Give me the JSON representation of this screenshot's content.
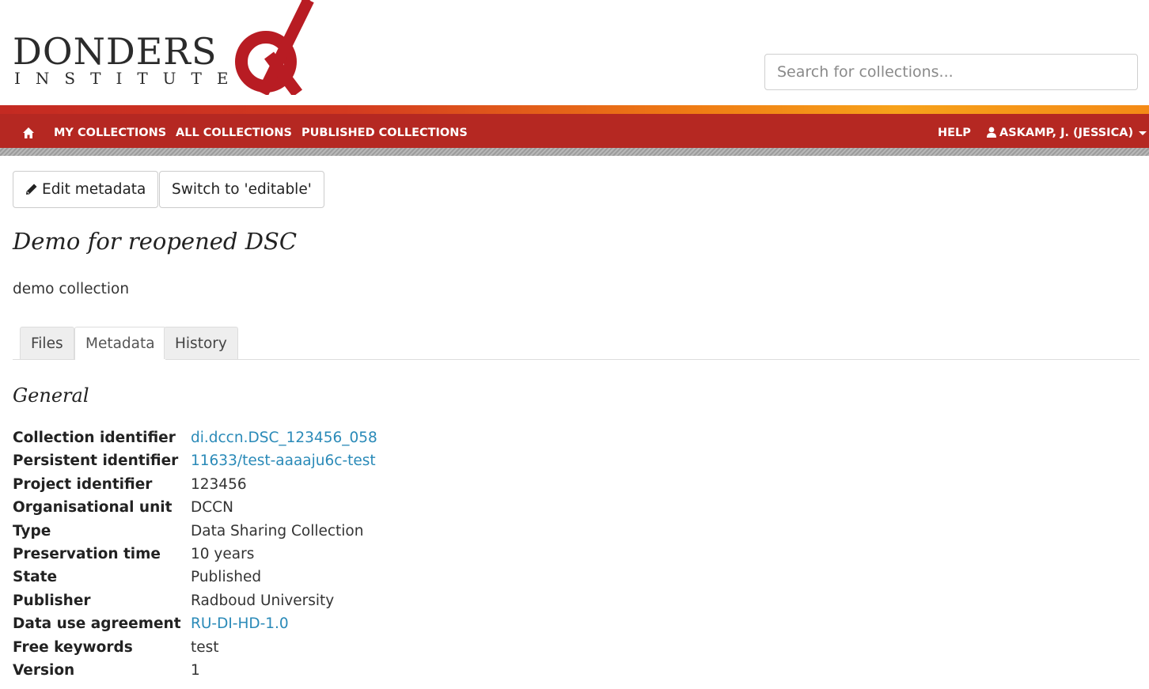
{
  "logo": {
    "word": "DONDERS",
    "sub": "INSTITUTE"
  },
  "search": {
    "placeholder": "Search for collections..."
  },
  "nav": {
    "home_icon": "home-icon",
    "items": [
      "MY COLLECTIONS",
      "ALL COLLECTIONS",
      "PUBLISHED COLLECTIONS"
    ],
    "help": "HELP",
    "user": "ASKAMP, J. (JESSICA)",
    "user_icon": "user-icon"
  },
  "actions": {
    "edit": "Edit metadata",
    "switch": "Switch to 'editable'"
  },
  "collection": {
    "title": "Demo for reopened DSC",
    "description": "demo collection"
  },
  "tabs": [
    {
      "label": "Files",
      "active": false
    },
    {
      "label": "Metadata",
      "active": true
    },
    {
      "label": "History",
      "active": false
    }
  ],
  "section": {
    "title": "General"
  },
  "metadata": [
    {
      "key": "Collection identifier",
      "value": "di.dccn.DSC_123456_058",
      "link": true
    },
    {
      "key": "Persistent identifier",
      "value": "11633/test-aaaaju6c-test",
      "link": true
    },
    {
      "key": "Project identifier",
      "value": "123456",
      "link": false
    },
    {
      "key": "Organisational unit",
      "value": "DCCN",
      "link": false
    },
    {
      "key": "Type",
      "value": "Data Sharing Collection",
      "link": false
    },
    {
      "key": "Preservation time",
      "value": "10 years",
      "link": false
    },
    {
      "key": "State",
      "value": "Published",
      "link": false
    },
    {
      "key": "Publisher",
      "value": "Radboud University",
      "link": false
    },
    {
      "key": "Data use agreement",
      "value": "RU-DI-HD-1.0",
      "link": true
    },
    {
      "key": "Free keywords",
      "value": "test",
      "link": false
    },
    {
      "key": "Version",
      "value": "1",
      "link": false
    }
  ],
  "colors": {
    "nav_red": "#b52822",
    "link_blue": "#2a8ab8",
    "band_orange": "#f7a21a"
  }
}
